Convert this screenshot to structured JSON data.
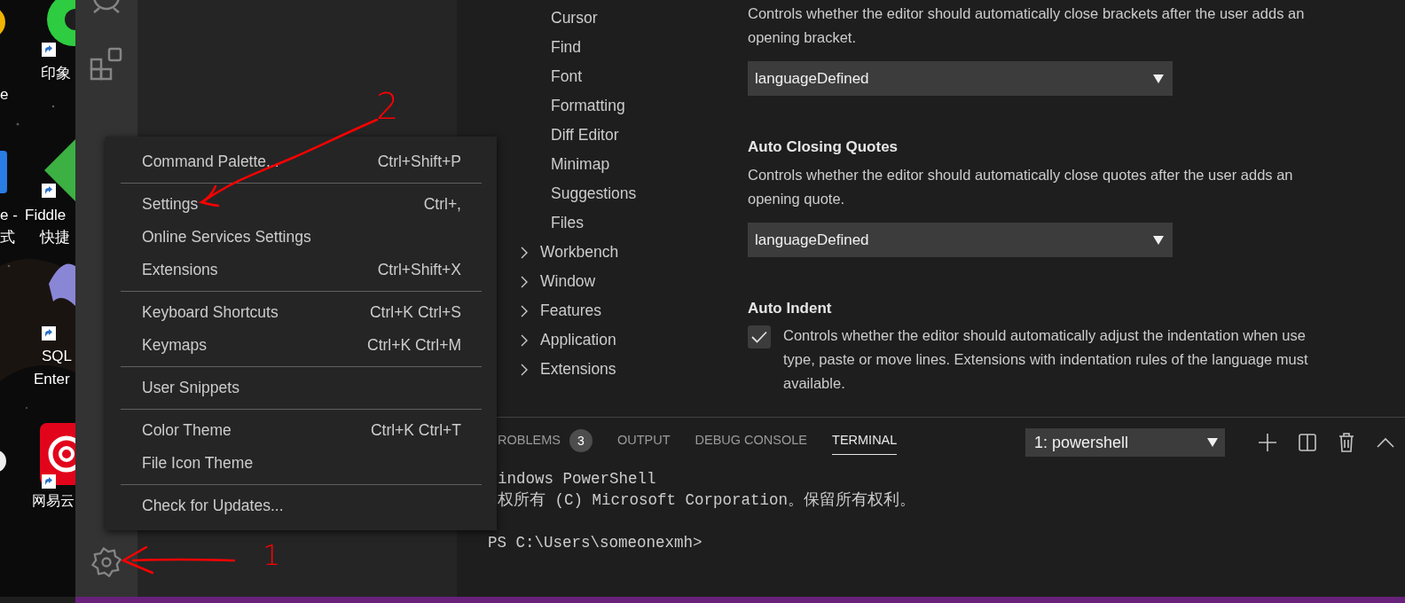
{
  "desktop": {
    "labels": [
      "e",
      "e -",
      "式",
      "印象",
      "Fiddle",
      "快捷",
      "SQL",
      "Enter",
      "网易云"
    ]
  },
  "menu": {
    "groups": [
      [
        {
          "label": "Command Palette...",
          "shortcut": "Ctrl+Shift+P"
        }
      ],
      [
        {
          "label": "Settings",
          "shortcut": "Ctrl+,"
        },
        {
          "label": "Online Services Settings"
        },
        {
          "label": "Extensions",
          "shortcut": "Ctrl+Shift+X"
        }
      ],
      [
        {
          "label": "Keyboard Shortcuts",
          "shortcut": "Ctrl+K Ctrl+S"
        },
        {
          "label": "Keymaps",
          "shortcut": "Ctrl+K Ctrl+M"
        }
      ],
      [
        {
          "label": "User Snippets"
        }
      ],
      [
        {
          "label": "Color Theme",
          "shortcut": "Ctrl+K Ctrl+T"
        },
        {
          "label": "File Icon Theme"
        }
      ],
      [
        {
          "label": "Check for Updates..."
        }
      ]
    ]
  },
  "settings_tree": [
    {
      "label": "Cursor",
      "kind": "leaf"
    },
    {
      "label": "Find",
      "kind": "leaf"
    },
    {
      "label": "Font",
      "kind": "leaf"
    },
    {
      "label": "Formatting",
      "kind": "leaf"
    },
    {
      "label": "Diff Editor",
      "kind": "leaf"
    },
    {
      "label": "Minimap",
      "kind": "leaf"
    },
    {
      "label": "Suggestions",
      "kind": "leaf"
    },
    {
      "label": "Files",
      "kind": "leaf"
    },
    {
      "label": "Workbench",
      "kind": "group",
      "expanded": false
    },
    {
      "label": "Window",
      "kind": "group",
      "expanded": false
    },
    {
      "label": "Features",
      "kind": "group",
      "expanded": false
    },
    {
      "label": "Application",
      "kind": "group",
      "expanded": false
    },
    {
      "label": "Extensions",
      "kind": "group",
      "expanded": false
    }
  ],
  "settings": [
    {
      "kind": "dropdown",
      "description_lines": [
        "Controls whether the editor should automatically close brackets after the user adds an",
        "opening bracket."
      ],
      "value": "languageDefined"
    },
    {
      "kind": "dropdown",
      "title": "Auto Closing Quotes",
      "description_lines": [
        "Controls whether the editor should automatically close quotes after the user adds an",
        "opening quote."
      ],
      "value": "languageDefined"
    },
    {
      "kind": "checkbox",
      "title": "Auto Indent",
      "checked": true,
      "description_lines": [
        "Controls whether the editor should automatically adjust the indentation when use",
        "type, paste or move lines. Extensions with indentation rules of the language must",
        "available."
      ]
    }
  ],
  "panel": {
    "tabs": [
      {
        "label": "ROBLEMS",
        "badge": "3",
        "selected": false
      },
      {
        "label": "OUTPUT",
        "selected": false
      },
      {
        "label": "DEBUG CONSOLE",
        "selected": false
      },
      {
        "label": "TERMINAL",
        "selected": true
      }
    ],
    "terminal_select": "1: powershell",
    "terminal_lines": [
      {
        "kind": "output",
        "text": "indows PowerShell"
      },
      {
        "kind": "output",
        "text": "权所有 (C) Microsoft Corporation。保留所有权利。"
      },
      {
        "kind": "prompt",
        "text": "PS C:\\Users\\someonexmh>"
      }
    ]
  },
  "annotations": [
    {
      "label": "2"
    },
    {
      "label": "1"
    }
  ]
}
